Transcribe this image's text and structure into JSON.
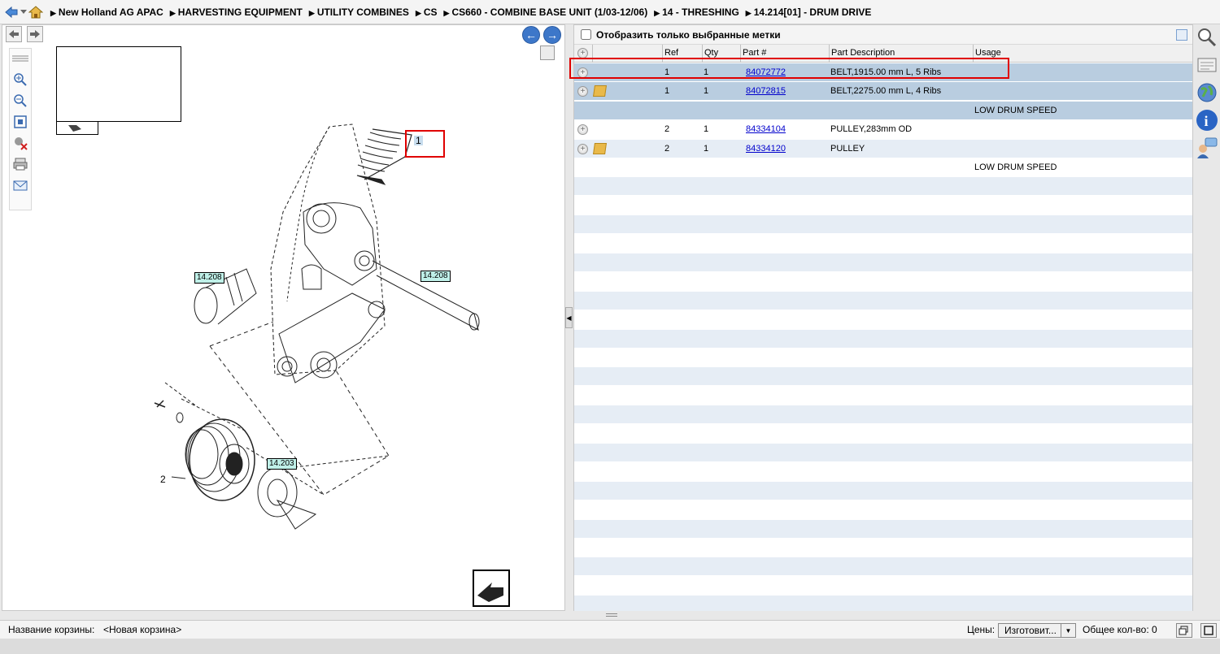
{
  "breadcrumb": [
    "New Holland AG APAC",
    "HARVESTING EQUIPMENT",
    "UTILITY COMBINES",
    "CS",
    "CS660 - COMBINE BASE UNIT (1/03-12/06)",
    "14 - THRESHING",
    "14.214[01] - DRUM DRIVE"
  ],
  "filter": {
    "label": "Отобразить только выбранные метки",
    "checked": false
  },
  "table": {
    "headers": {
      "ref": "Ref",
      "qty": "Qty",
      "part": "Part #",
      "desc": "Part Description",
      "usage": "Usage"
    },
    "rows": [
      {
        "ref": "1",
        "qty": "1",
        "part": "84072772",
        "desc": "BELT,1915.00 mm L, 5 Ribs",
        "usage": "",
        "box": false
      },
      {
        "ref": "1",
        "qty": "1",
        "part": "84072815",
        "desc": "BELT,2275.00 mm L, 4 Ribs",
        "usage": "",
        "box": true
      },
      {
        "ref": "",
        "qty": "",
        "part": "",
        "desc": "",
        "usage": "LOW DRUM SPEED",
        "box": false
      },
      {
        "ref": "2",
        "qty": "1",
        "part": "84334104",
        "desc": "PULLEY,283mm OD",
        "usage": "",
        "box": false
      },
      {
        "ref": "2",
        "qty": "1",
        "part": "84334120",
        "desc": "PULLEY",
        "usage": "",
        "box": true
      },
      {
        "ref": "",
        "qty": "",
        "part": "",
        "desc": "",
        "usage": "LOW DRUM SPEED",
        "box": false
      }
    ]
  },
  "diagram": {
    "callout_1": "1",
    "callout_2": "2",
    "tag_a": "14.208",
    "tag_b": "14.208",
    "tag_c": "14.203"
  },
  "status": {
    "cart_label": "Название корзины:",
    "cart_value": "<Новая корзина>",
    "prices_label": "Цены:",
    "manufacturer": "Изготовит...",
    "total_label": "Общее кол-во: 0"
  },
  "colors": {
    "highlight_row": "#b9cde0",
    "stripe": "#e6edf5",
    "red_box": "#e00000"
  }
}
